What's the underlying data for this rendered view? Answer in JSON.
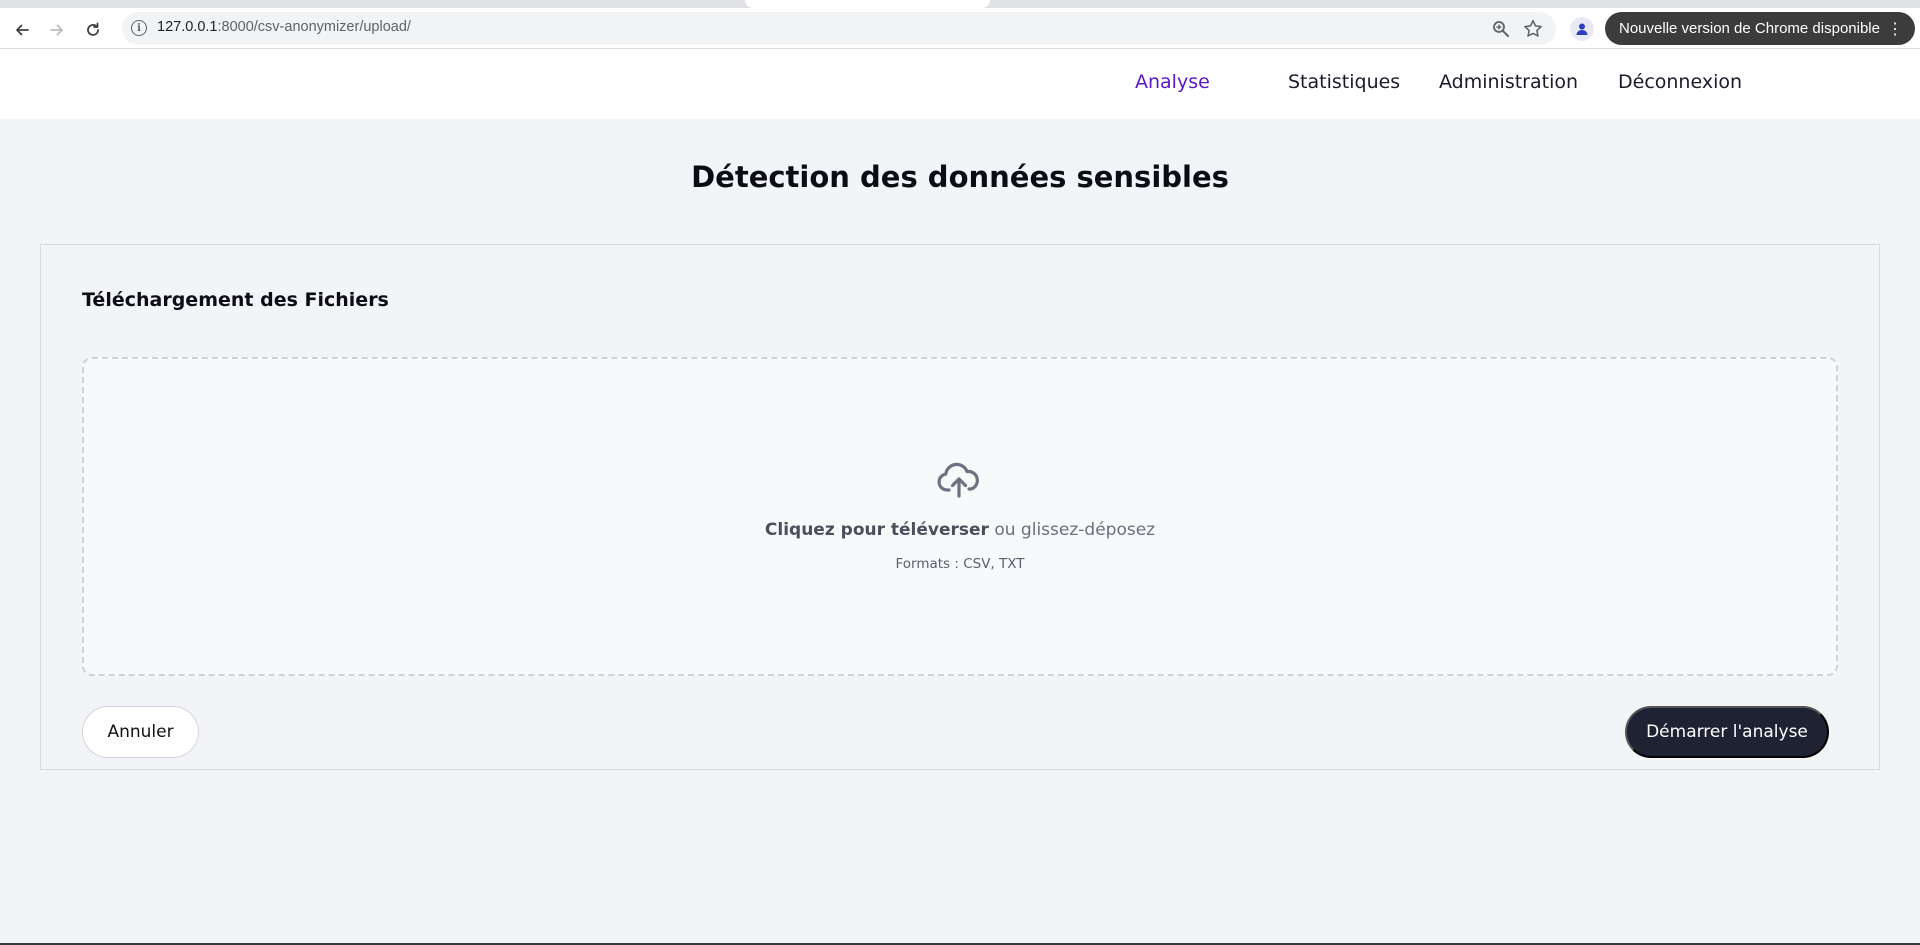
{
  "browser": {
    "url_host": "127.0.0.1",
    "url_path": ":8000/csv-anonymizer/upload/",
    "update_label": "Nouvelle version de Chrome disponible",
    "icons": [
      "back-icon",
      "forward-icon",
      "reload-icon",
      "site-info-icon",
      "zoom-icon",
      "bookmark-star-icon",
      "profile-icon",
      "kebab-menu-icon"
    ]
  },
  "nav": {
    "items": [
      {
        "label": "Analyse",
        "active": true
      },
      {
        "label": "Statistiques"
      },
      {
        "label": "Administration"
      },
      {
        "label": "Déconnexion"
      }
    ],
    "active_color": "#5a16c7"
  },
  "page": {
    "title": "Détection des données sensibles"
  },
  "upload_card": {
    "title": "Téléchargement des Fichiers",
    "dropzone": {
      "icon": "cloud-upload-icon",
      "click_text": "Cliquez pour téléverser",
      "drop_text": " ou glissez-déposez",
      "formats": "Formats : CSV, TXT"
    },
    "cancel_label": "Annuler",
    "start_label": "Démarrer l'analyse",
    "start_color": "#1f2232"
  }
}
